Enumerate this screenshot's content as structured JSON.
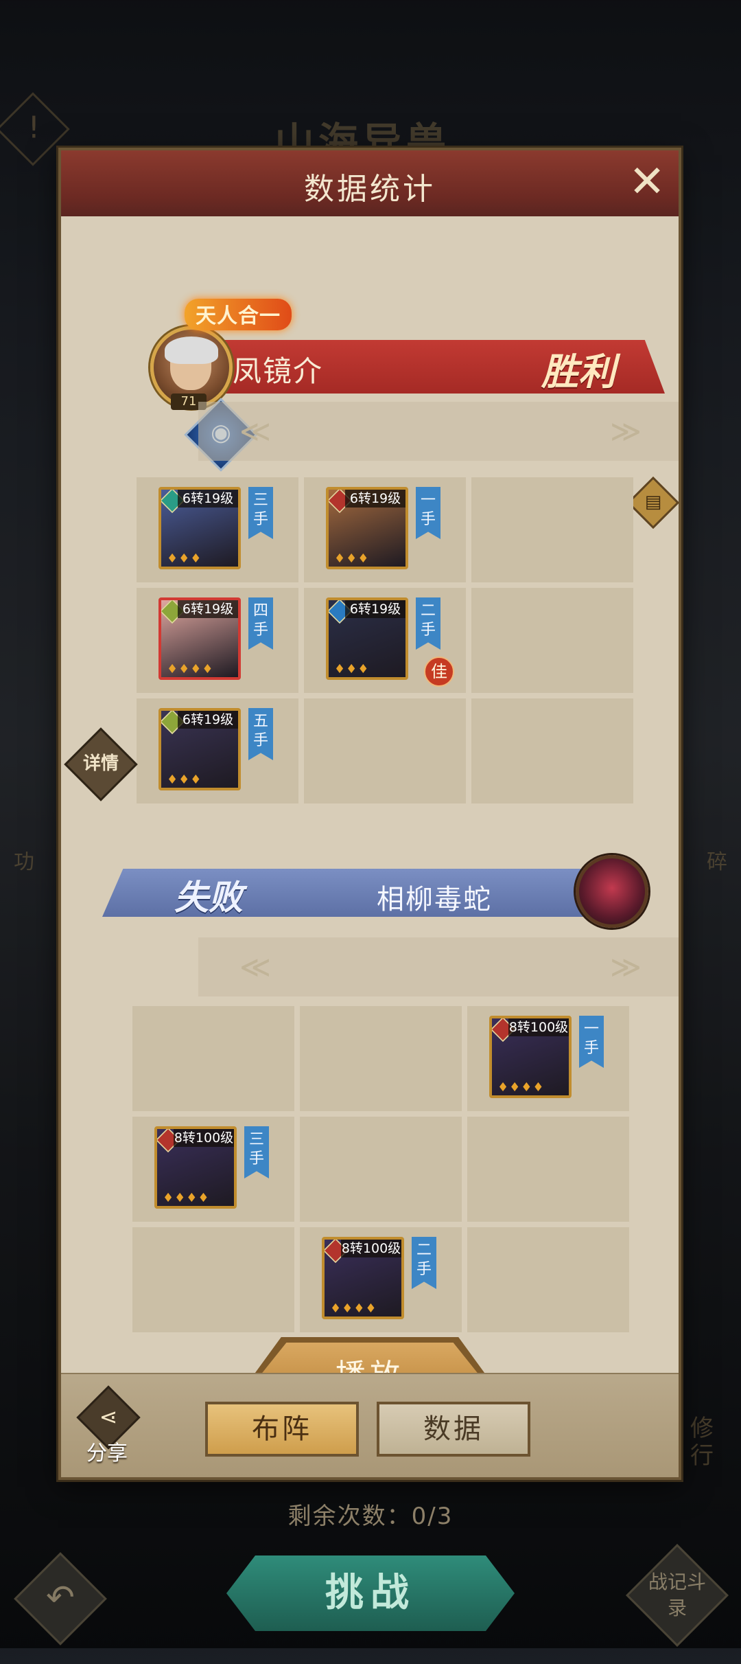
{
  "background": {
    "title": "山海异兽",
    "warning_icon": "exclamation-icon",
    "side_left": "功",
    "side_right": "碎",
    "side_right_bottom": "修行"
  },
  "modal": {
    "title": "数据统计",
    "close_icon": "close-icon",
    "winner": {
      "title_badge": "天人合一",
      "name": "凤镜介",
      "level": "71",
      "result": "胜利",
      "pet_icon": "dragon-icon",
      "units": [
        {
          "level_text": "6转19级",
          "turn": "三手",
          "stars": "♦♦♦",
          "attr_color": "#2a9c86",
          "art_color": "#4b5d9a",
          "slot": 1,
          "highlight": false,
          "jia": ""
        },
        {
          "level_text": "6转19级",
          "turn": "一手",
          "stars": "♦♦♦",
          "attr_color": "#b3342c",
          "art_color": "#a56b3f",
          "slot": 2,
          "highlight": false,
          "jia": ""
        },
        {
          "level_text": "6转19级",
          "turn": "四手",
          "stars": "♦♦♦♦",
          "attr_color": "#8da63a",
          "art_color": "#e0a7a0",
          "slot": 4,
          "highlight": true,
          "jia": ""
        },
        {
          "level_text": "6转19级",
          "turn": "二手",
          "stars": "♦♦♦",
          "attr_color": "#2a7bc0",
          "art_color": "#2b2f48",
          "slot": 5,
          "highlight": false,
          "jia": "佳"
        },
        {
          "level_text": "6转19级",
          "turn": "五手",
          "stars": "♦♦♦",
          "attr_color": "#8da63a",
          "art_color": "#3a3454",
          "slot": 7,
          "highlight": false,
          "jia": ""
        }
      ],
      "detail_label": "详情",
      "doc_icon": "document-icon"
    },
    "loser": {
      "result": "失败",
      "name": "相柳毒蛇",
      "units": [
        {
          "level_text": "8转100级",
          "turn": "一手",
          "stars": "♦♦♦♦",
          "attr_color": "#b3342c",
          "art_color": "#3a2f5a",
          "slot": 3,
          "highlight": false,
          "jia": ""
        },
        {
          "level_text": "8转100级",
          "turn": "三手",
          "stars": "♦♦♦♦",
          "attr_color": "#b3342c",
          "art_color": "#3a2f5a",
          "slot": 4,
          "highlight": false,
          "jia": ""
        },
        {
          "level_text": "8转100级",
          "turn": "二手",
          "stars": "♦♦♦♦",
          "attr_color": "#b3342c",
          "art_color": "#3a2f5a",
          "slot": 8,
          "highlight": false,
          "jia": ""
        }
      ]
    },
    "play_label": "播放",
    "footer": {
      "share_label": "分享",
      "share_icon": "share-icon",
      "formation_label": "布阵",
      "data_label": "数据"
    }
  },
  "remaining_text": "剩余次数：0/3",
  "challenge_label": "挑战",
  "back_icon": "back-arrow-icon",
  "record_label": "战记斗录"
}
